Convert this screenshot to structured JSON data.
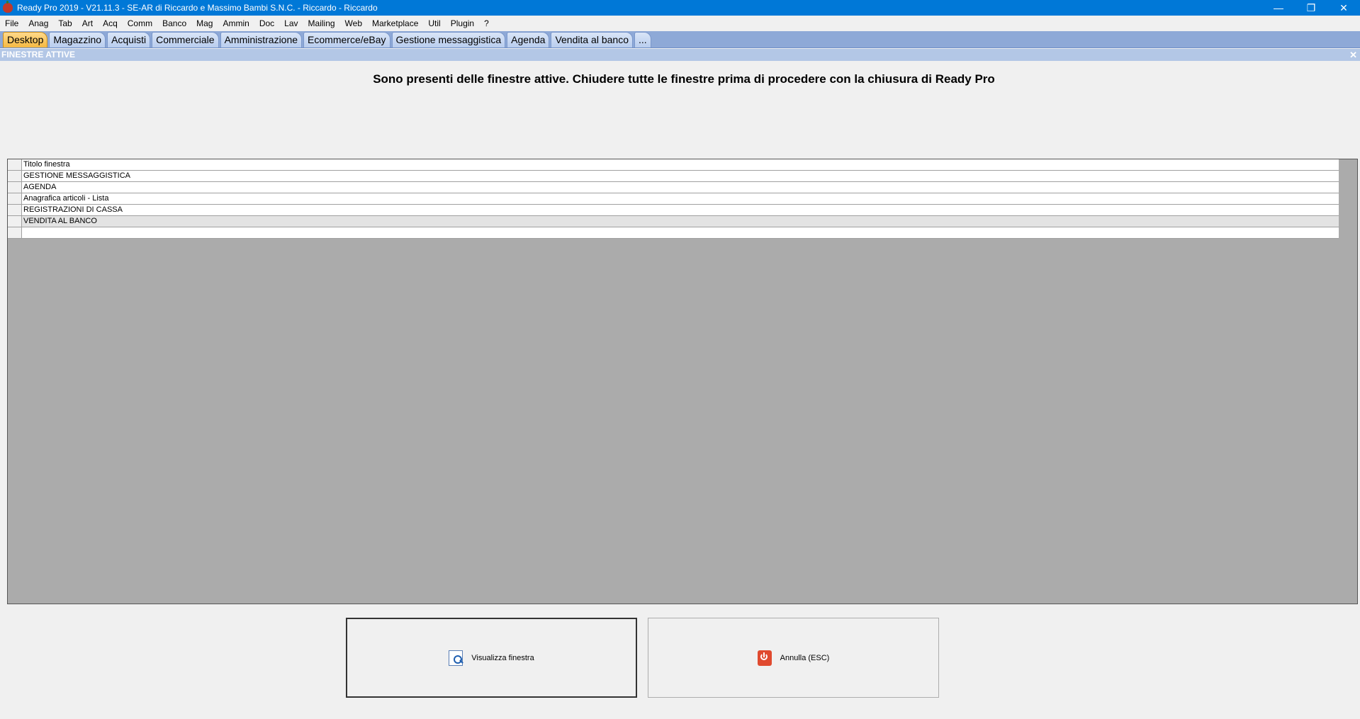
{
  "window": {
    "title": "Ready Pro 2019 - V21.11.3 - SE-AR di Riccardo e Massimo Bambi S.N.C. - Riccardo - Riccardo",
    "minimize": "—",
    "restore": "❐",
    "close": "✕"
  },
  "menu": [
    "File",
    "Anag",
    "Tab",
    "Art",
    "Acq",
    "Comm",
    "Banco",
    "Mag",
    "Ammin",
    "Doc",
    "Lav",
    "Mailing",
    "Web",
    "Marketplace",
    "Util",
    "Plugin",
    "?"
  ],
  "tabs": [
    "Desktop",
    "Magazzino",
    "Acquisti",
    "Commerciale",
    "Amministrazione",
    "Ecommerce/eBay",
    "Gestione messaggistica",
    "Agenda",
    "Vendita al banco",
    "..."
  ],
  "active_tab": "Desktop",
  "section": {
    "title": "FINESTRE ATTIVE",
    "close": "✕"
  },
  "message": "Sono presenti delle finestre attive. Chiudere tutte le finestre prima di procedere con la chiusura di Ready Pro",
  "grid": {
    "header": "Titolo finestra",
    "rows": [
      "GESTIONE MESSAGGISTICA",
      "AGENDA",
      "Anagrafica articoli  - Lista",
      "REGISTRAZIONI DI CASSA",
      "VENDITA AL BANCO"
    ]
  },
  "buttons": {
    "view": "Visualizza finestra",
    "cancel": "Annulla (ESC)"
  },
  "colors": {
    "titlebar": "#0078d7",
    "tabstrip": "#8ea9d7",
    "active_tab": "#f5b942",
    "section_header": "#b3c7e6"
  }
}
